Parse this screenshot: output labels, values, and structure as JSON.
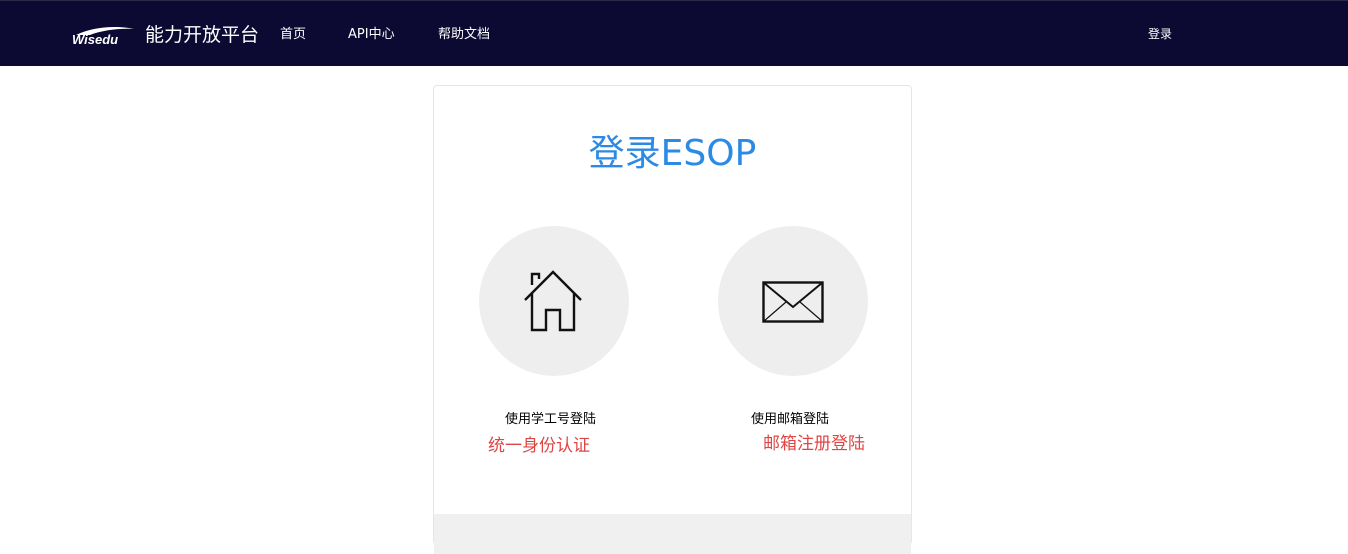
{
  "header": {
    "logo_text": "Wisedu",
    "platform_title": "能力开放平台",
    "nav": [
      {
        "label": "首页"
      },
      {
        "label": "API中心"
      },
      {
        "label": "帮助文档"
      }
    ],
    "login_label": "登录",
    "background_color": "#0c0933"
  },
  "login_card": {
    "title": "登录ESOP",
    "title_color": "#2b8ae4",
    "options": [
      {
        "icon": "house-icon",
        "label": "使用学工号登陆",
        "note": "统一身份认证"
      },
      {
        "icon": "envelope-icon",
        "label": "使用邮箱登陆",
        "note": "邮箱注册登陆"
      }
    ],
    "note_color": "#e04545"
  }
}
